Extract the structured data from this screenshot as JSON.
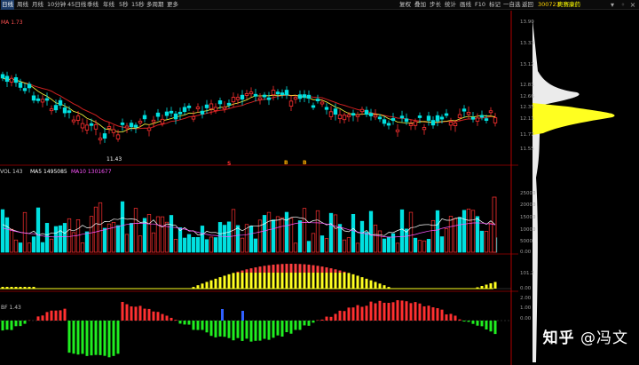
{
  "toolbar": {
    "periods": [
      "日线",
      "周线",
      "月线",
      "10分钟",
      "45日线",
      "季线",
      "年线",
      "5秒",
      "15秒",
      "多周期",
      "更多"
    ],
    "tools": [
      "复权",
      "叠加",
      "步长",
      "统计",
      "画线",
      "F10",
      "标记",
      "一自选",
      "返回"
    ],
    "stock_code": "300723",
    "stock_name": "奥赛康药"
  },
  "panels": {
    "main_label": "MA 1.73",
    "vol_legend": [
      {
        "text": "VOL 143",
        "color": "#d0d0d0"
      },
      {
        "text": "MA5 1495085",
        "color": "#ffffff"
      },
      {
        "text": "MA10 1301677",
        "color": "#ff55ff"
      }
    ],
    "cost_label": "11.43",
    "lower_label": "BF 1.43"
  },
  "axis": {
    "price_ticks": [
      "13.90",
      "13.33",
      "13.12",
      "12.81",
      "12.66",
      "12.35",
      "12.11",
      "11.77",
      "11.55"
    ],
    "vol_ticks": [
      "25000",
      "20000",
      "15000",
      "10000",
      "5000",
      "0.00"
    ],
    "mid_ticks": [
      "101.2",
      "0.00"
    ],
    "lower_ticks": [
      "2.00",
      "1.00",
      "0.00"
    ]
  },
  "markers": [
    {
      "text": "S",
      "color": "#ff3030"
    },
    {
      "text": "B",
      "color": "#ffb000"
    }
  ],
  "watermark": {
    "logo": "知乎",
    "handle": "@冯文"
  },
  "colors": {
    "up": "#ff3030",
    "down": "#00e0e0",
    "ma5": "#ffffff",
    "ma10": "#ff55ff",
    "yellow": "#ffff20",
    "green": "#20ee20",
    "axis": "#b00000"
  }
}
